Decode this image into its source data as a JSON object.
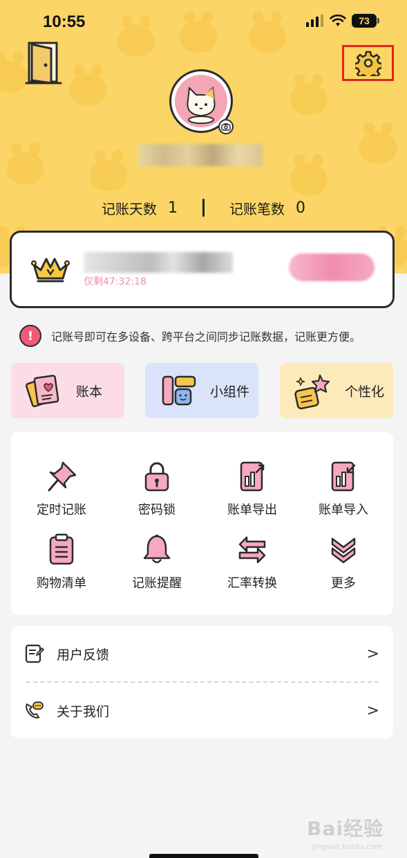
{
  "status_bar": {
    "time": "10:55",
    "battery": "73"
  },
  "profile": {
    "stats": {
      "days_label": "记账天数",
      "days_value": "1",
      "records_label": "记账笔数",
      "records_value": "0"
    }
  },
  "vip": {
    "subtitle": "仅剩47:32:18"
  },
  "notice": {
    "text": "记账号即可在多设备、跨平台之间同步记账数据，记账更方便。"
  },
  "quick_cards": [
    {
      "label": "账本"
    },
    {
      "label": "小组件"
    },
    {
      "label": "个性化"
    }
  ],
  "tools": [
    {
      "label": "定时记账",
      "icon": "pushpin-icon"
    },
    {
      "label": "密码锁",
      "icon": "lock-icon"
    },
    {
      "label": "账单导出",
      "icon": "export-icon"
    },
    {
      "label": "账单导入",
      "icon": "import-icon"
    },
    {
      "label": "购物清单",
      "icon": "clipboard-icon"
    },
    {
      "label": "记账提醒",
      "icon": "bell-icon"
    },
    {
      "label": "汇率转换",
      "icon": "exchange-icon"
    },
    {
      "label": "更多",
      "icon": "chevron-double-down-icon"
    }
  ],
  "list": [
    {
      "label": "用户反馈",
      "icon": "feedback-icon",
      "chevron": ">"
    },
    {
      "label": "关于我们",
      "icon": "chat-phone-icon",
      "chevron": ">"
    }
  ],
  "watermark": {
    "text": "Bai经验",
    "sub": "jingyan.baidu.com"
  },
  "colors": {
    "header_yellow": "#fbd566",
    "pink": "#f08cab",
    "highlight_red": "#e2231a",
    "background": "#f4f4f4"
  }
}
